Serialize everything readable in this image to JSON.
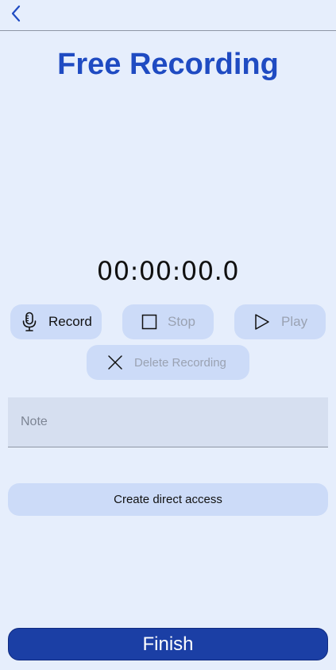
{
  "header": {
    "back_icon": "chevron-left-icon"
  },
  "page": {
    "title": "Free Recording",
    "timer": "00:00:00.0"
  },
  "controls": {
    "record": {
      "label": "Record",
      "icon": "microphone-icon",
      "enabled": true
    },
    "stop": {
      "label": "Stop",
      "icon": "stop-square-icon",
      "enabled": false
    },
    "play": {
      "label": "Play",
      "icon": "play-triangle-icon",
      "enabled": false
    },
    "delete": {
      "label": "Delete Recording",
      "icon": "close-x-icon",
      "enabled": false
    }
  },
  "note": {
    "placeholder": "Note",
    "value": ""
  },
  "direct_access": {
    "label": "Create direct access"
  },
  "finish": {
    "label": "Finish"
  },
  "colors": {
    "background": "#e6eefc",
    "accent": "#1f4bc2",
    "button_bg": "#ccdbf8",
    "finish_bg": "#1b3fa5",
    "disabled_text": "#9aa2b2"
  }
}
